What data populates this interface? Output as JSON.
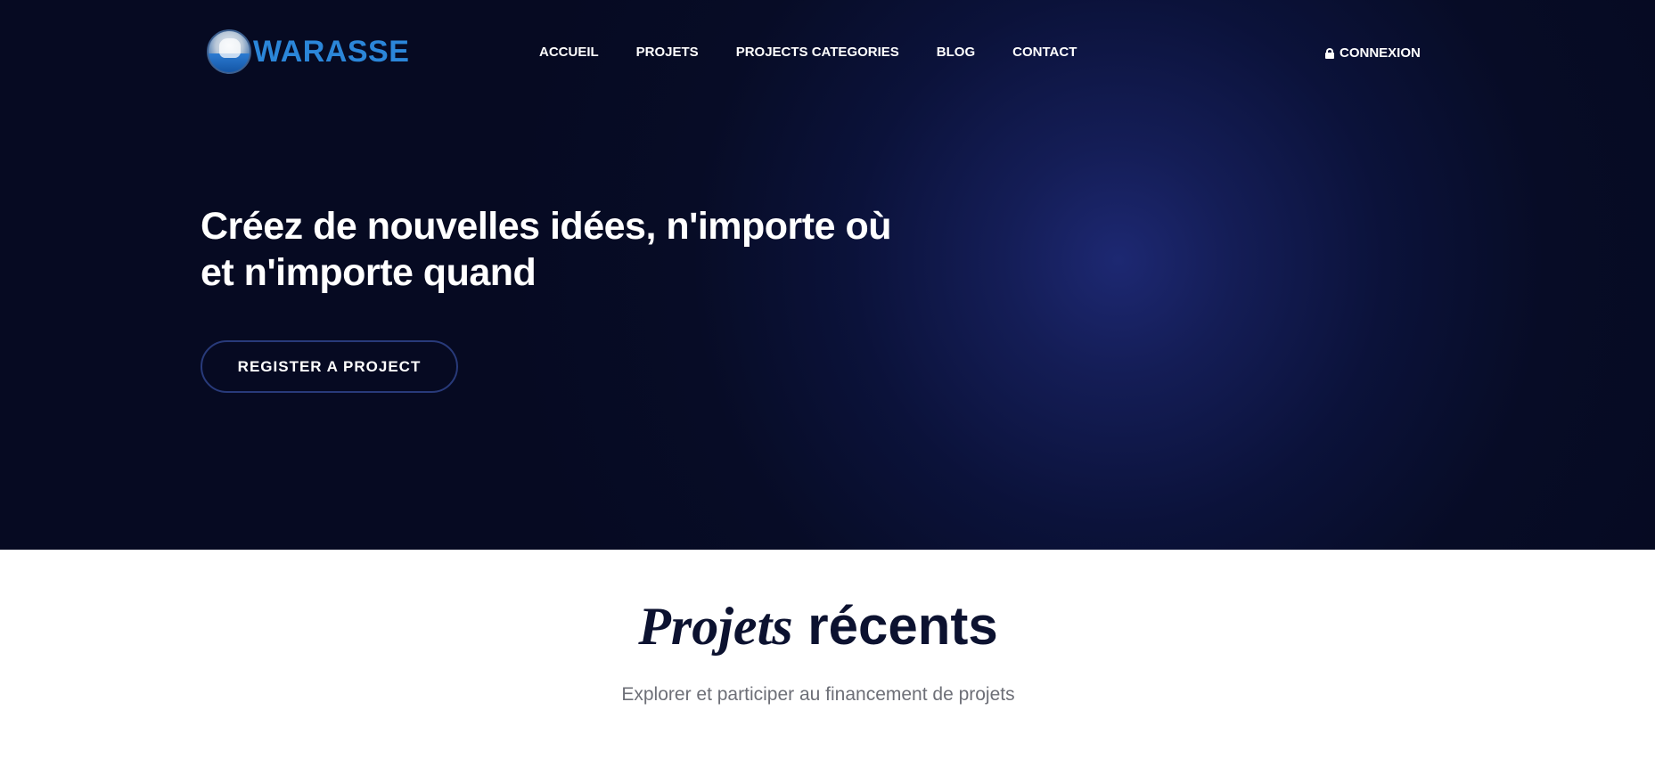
{
  "header": {
    "logo_text": "WARASSE",
    "nav": [
      {
        "label": "ACCUEIL"
      },
      {
        "label": "PROJETS"
      },
      {
        "label": "PROJECTS CATEGORIES"
      },
      {
        "label": "BLOG"
      },
      {
        "label": "CONTACT"
      }
    ],
    "login_label": "CONNEXION",
    "login_icon": "lock-icon"
  },
  "hero": {
    "title": "Créez de nouvelles idées, n'importe où et n'importe quand",
    "cta_label": "REGISTER A PROJECT"
  },
  "recent": {
    "title_italic": "Projets",
    "title_bold": "récents",
    "subtitle": "Explorer et participer au financement de projets"
  },
  "colors": {
    "hero_background": "#060a22",
    "hero_glow": "#1d2872",
    "logo_blue": "#2b86d9",
    "title_dark": "#0c1230",
    "subtitle_gray": "#6d6f77"
  }
}
